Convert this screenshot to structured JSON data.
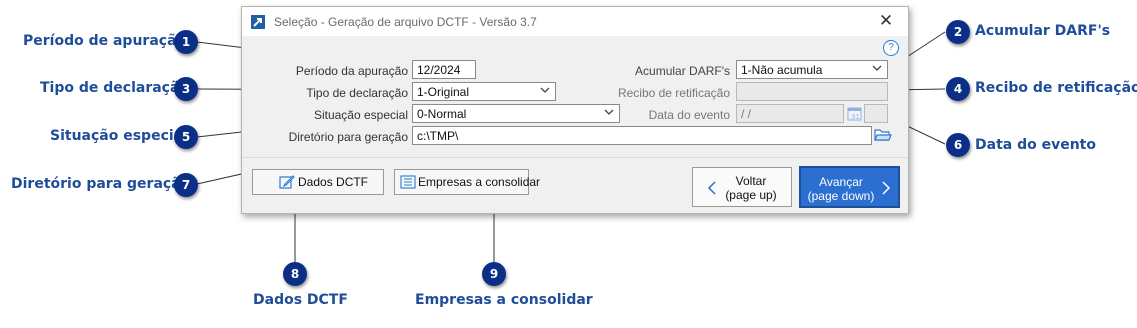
{
  "window": {
    "title": "Seleção - Geração de arquivo DCTF - Versão 3.7",
    "close_label": "✕",
    "help_label": "?"
  },
  "form": {
    "periodo_label": "Período da apuração",
    "periodo_value": "12/2024",
    "tipo_label": "Tipo de declaração",
    "tipo_value": "1-Original",
    "situacao_label": "Situação especial",
    "situacao_value": "0-Normal",
    "diretorio_label": "Diretório para geração",
    "diretorio_value": "c:\\TMP\\",
    "acumular_label": "Acumular DARF's",
    "acumular_value": "1-Não acumula",
    "recibo_label": "Recibo de retificação",
    "recibo_value": "",
    "data_evento_label": "Data do evento",
    "data_evento_value": " /  /"
  },
  "buttons": {
    "dados_dctf": "Dados DCTF",
    "empresas": "Empresas a consolidar",
    "voltar_line1": "Voltar",
    "voltar_line2": "(page up)",
    "avancar_line1": "Avançar",
    "avancar_line2": "(page down)"
  },
  "callouts": [
    {
      "number": "1",
      "label": "Período de apuração"
    },
    {
      "number": "2",
      "label": "Acumular DARF's"
    },
    {
      "number": "3",
      "label": "Tipo de declaração"
    },
    {
      "number": "4",
      "label": "Recibo de retificação"
    },
    {
      "number": "5",
      "label": "Situação especial"
    },
    {
      "number": "6",
      "label": "Data do evento"
    },
    {
      "number": "7",
      "label": "Diretório para geração"
    },
    {
      "number": "8",
      "label": "Dados DCTF"
    },
    {
      "number": "9",
      "label": "Empresas a consolidar"
    }
  ],
  "colors": {
    "callout_text": "#1f4e99",
    "badge": "#0b2e87",
    "primary_button": "#2b6fd1"
  }
}
